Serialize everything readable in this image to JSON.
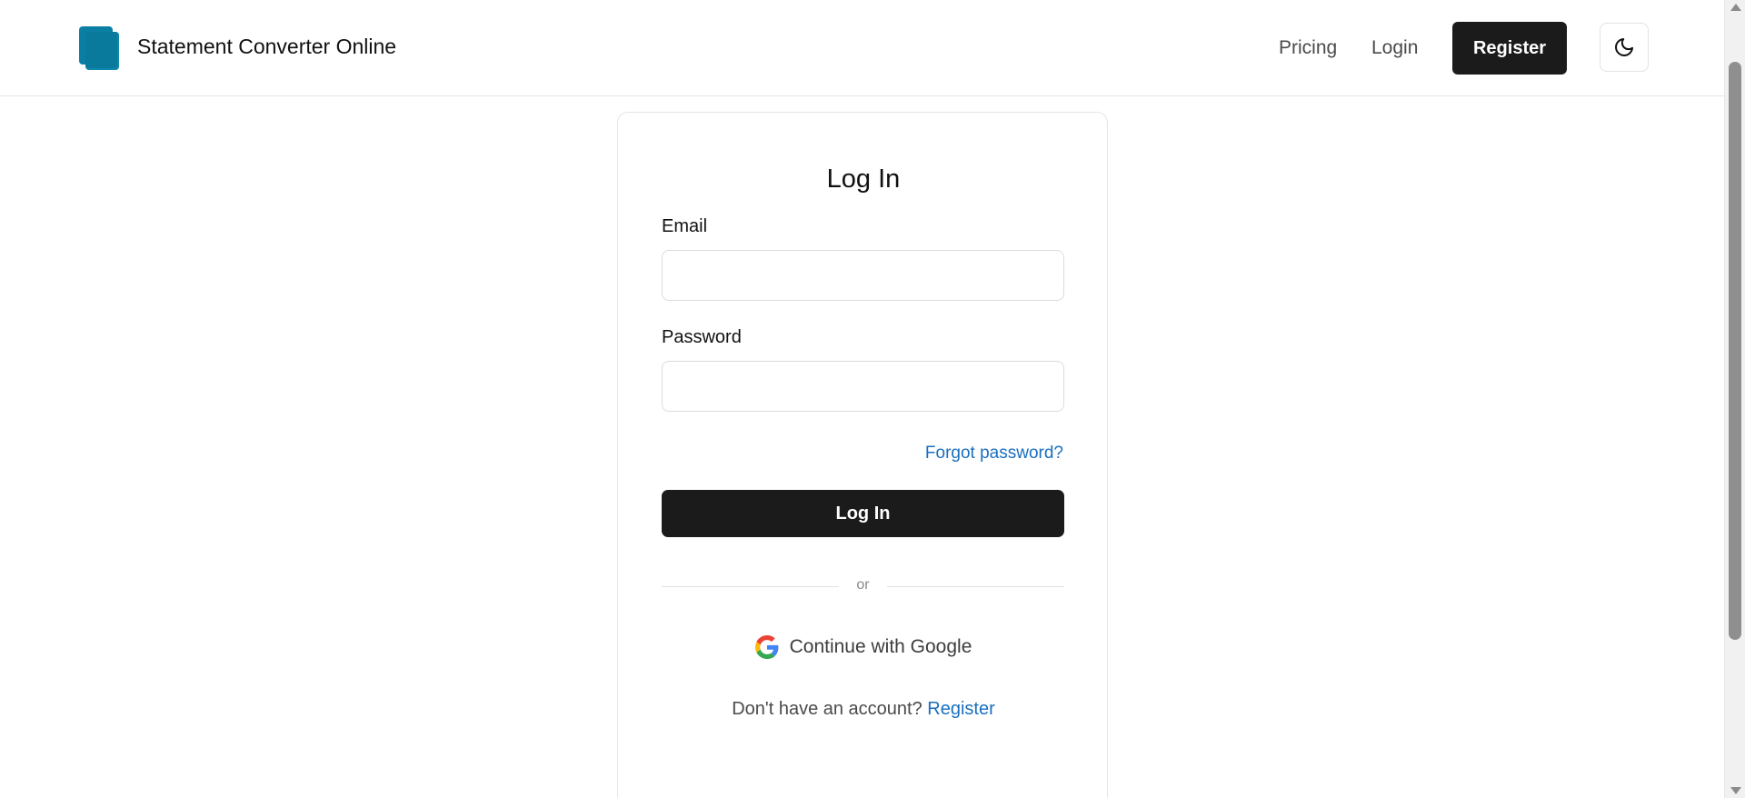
{
  "header": {
    "brand": "Statement Converter Online",
    "nav": {
      "pricing": "Pricing",
      "login": "Login",
      "register": "Register"
    },
    "logo_color": "#0b7fa3",
    "theme_icon": "moon-icon"
  },
  "login_card": {
    "title": "Log In",
    "email_label": "Email",
    "email_value": "",
    "password_label": "Password",
    "password_value": "",
    "forgot_link": "Forgot password?",
    "submit_label": "Log In",
    "divider_text": "or",
    "google_label": "Continue with Google",
    "google_icon": "google-icon",
    "account_prompt": "Don't have an account?",
    "register_link": "Register"
  },
  "colors": {
    "primary_button": "#1b1b1b",
    "link": "#1a6fbf"
  }
}
